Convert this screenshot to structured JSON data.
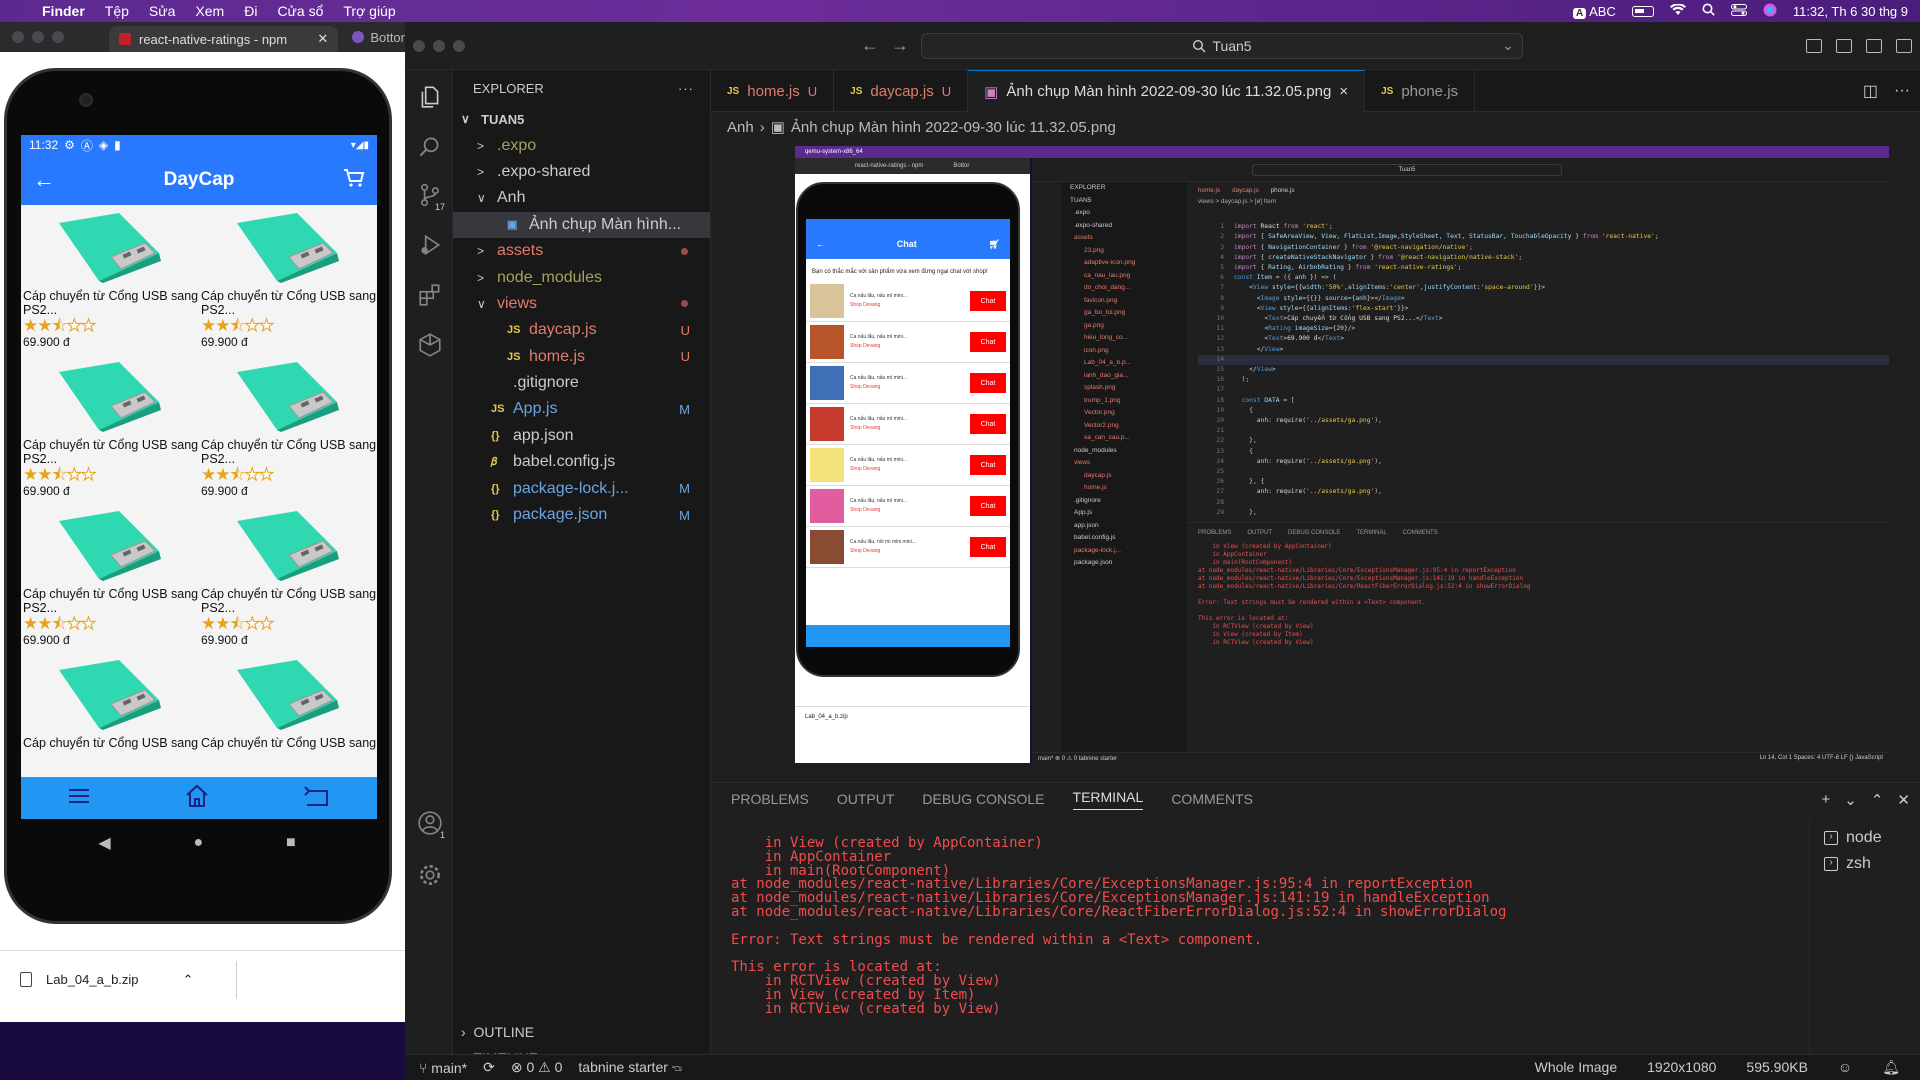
{
  "menubar": {
    "app": "Finder",
    "items": [
      "Tệp",
      "Sửa",
      "Xem",
      "Đi",
      "Cửa sổ",
      "Trợ giúp"
    ],
    "keyboard": "ABC",
    "clock": "11:32, Th 6 30 thg 9"
  },
  "browser": {
    "tab_title": "react-native-ratings - npm",
    "tab2_title": "Bottor",
    "download_file": "Lab_04_a_b.zip"
  },
  "phone": {
    "time": "11:32",
    "app_title": "DayCap",
    "products": [
      {
        "name": "Cáp chuyển từ Cổng USB sang PS2...",
        "price": "69.900 đ",
        "rating": 2.5
      },
      {
        "name": "Cáp chuyển từ Cổng USB sang PS2...",
        "price": "69.900 đ",
        "rating": 2.5
      },
      {
        "name": "Cáp chuyển từ Cổng USB sang PS2...",
        "price": "69.900 đ",
        "rating": 2.5
      },
      {
        "name": "Cáp chuyển từ Cổng USB sang PS2...",
        "price": "69.900 đ",
        "rating": 2.5
      },
      {
        "name": "Cáp chuyển từ Cổng USB sang PS2...",
        "price": "69.900 đ",
        "rating": 2.5
      },
      {
        "name": "Cáp chuyển từ Cổng USB sang PS2...",
        "price": "69.900 đ",
        "rating": 2.5
      },
      {
        "name": "Cáp chuyển từ Cổng USB sang",
        "price": "",
        "rating": 0
      },
      {
        "name": "Cáp chuyển từ Cổng USB sang",
        "price": "",
        "rating": 0
      }
    ]
  },
  "vscode": {
    "search": "Tuan5",
    "explorer_title": "EXPLORER",
    "source_control_badge": "17",
    "accounts_badge": "1",
    "tree": [
      {
        "label": "TUAN5",
        "kind": "root",
        "chev": "∨",
        "indent": 0
      },
      {
        "label": ".expo",
        "kind": "folder",
        "chev": ">",
        "indent": 1,
        "color": "c-olive"
      },
      {
        "label": ".expo-shared",
        "kind": "folder",
        "chev": ">",
        "indent": 1,
        "color": ""
      },
      {
        "label": "Anh",
        "kind": "folder",
        "chev": "∨",
        "indent": 1,
        "color": ""
      },
      {
        "label": "Ảnh chụp Màn hình...",
        "kind": "image",
        "chev": "",
        "indent": 2,
        "color": "",
        "selected": true
      },
      {
        "label": "assets",
        "kind": "folder",
        "chev": ">",
        "indent": 1,
        "color": "c-red",
        "dot": true
      },
      {
        "label": "node_modules",
        "kind": "folder",
        "chev": ">",
        "indent": 1,
        "color": "c-olive"
      },
      {
        "label": "views",
        "kind": "folder",
        "chev": "∨",
        "indent": 1,
        "color": "c-red",
        "dot": true
      },
      {
        "label": "daycap.js",
        "kind": "js",
        "chev": "",
        "indent": 2,
        "color": "c-red",
        "tag": "U"
      },
      {
        "label": "home.js",
        "kind": "js",
        "chev": "",
        "indent": 2,
        "color": "c-red",
        "tag": "U"
      },
      {
        "label": ".gitignore",
        "kind": "git",
        "chev": "",
        "indent": 1,
        "color": ""
      },
      {
        "label": "App.js",
        "kind": "js",
        "chev": "",
        "indent": 1,
        "color": "c-blue",
        "tag": "M"
      },
      {
        "label": "app.json",
        "kind": "json",
        "chev": "",
        "indent": 1,
        "color": ""
      },
      {
        "label": "babel.config.js",
        "kind": "babel",
        "chev": "",
        "indent": 1,
        "color": ""
      },
      {
        "label": "package-lock.j...",
        "kind": "json",
        "chev": "",
        "indent": 1,
        "color": "c-blue",
        "tag": "M"
      },
      {
        "label": "package.json",
        "kind": "json",
        "chev": "",
        "indent": 1,
        "color": "c-blue",
        "tag": "M"
      }
    ],
    "outline": "OUTLINE",
    "timeline": "TIMELINE",
    "tabs": [
      {
        "label": "home.js",
        "icon": "JS",
        "status": "U",
        "active": false
      },
      {
        "label": "daycap.js",
        "icon": "JS",
        "status": "U",
        "active": false
      },
      {
        "label": "Ảnh chụp Màn hình 2022-09-30 lúc 11.32.05.png",
        "icon": "IMG",
        "status": "×",
        "active": true
      },
      {
        "label": "phone.js",
        "icon": "JS",
        "status": "",
        "active": false
      }
    ],
    "breadcrumb": [
      "Anh",
      "Ảnh chụp Màn hình 2022-09-30 lúc 11.32.05.png"
    ],
    "panel_tabs": [
      "PROBLEMS",
      "OUTPUT",
      "DEBUG CONSOLE",
      "TERMINAL",
      "COMMENTS"
    ],
    "terminal_lines": [
      "    in View (created by AppContainer)",
      "    in AppContainer",
      "    in main(RootComponent)",
      "at node_modules/react-native/Libraries/Core/ExceptionsManager.js:95:4 in reportException",
      "at node_modules/react-native/Libraries/Core/ExceptionsManager.js:141:19 in handleException",
      "at node_modules/react-native/Libraries/Core/ReactFiberErrorDialog.js:52:4 in showErrorDialog",
      "",
      "Error: Text strings must be rendered within a <Text> component.",
      "",
      "This error is located at:",
      "    in RCTView (created by View)",
      "    in View (created by Item)",
      "    in RCTView (created by View)"
    ],
    "terminals": [
      "node",
      "zsh"
    ],
    "status": {
      "branch": "main*",
      "errors": "0",
      "warnings": "0",
      "tabnine": "tabnine starter",
      "view_mode": "Whole Image",
      "dimensions": "1920x1080",
      "size": "595.90KB"
    }
  },
  "inner_screenshot": {
    "menubar": "qemu-system-x86_64",
    "browser_tab": "react-native-ratings - npm",
    "browser_tab2": "Bottor",
    "search": "Tuan5",
    "chat_title": "Chat",
    "chat_info": "Bạn có thắc mắc với sản phẩm vừa xem đừng ngại chat với shop!",
    "chat_button": "Chat",
    "chat_items": [
      "Ca nấu lẩu, nấu mì mini...",
      "Ca nấu lẩu, nấu mì mini...",
      "Ca nấu lẩu, nấu mì mini...",
      "Ca nấu lẩu, nấu mì mini...",
      "Ca nấu lẩu, nấu mì mini...",
      "Ca nấu lẩu, nấu mì mini...",
      "Ca nấu lẩu, nồi mì mini mini..."
    ],
    "shop": "Shop Devang",
    "download": "Lab_04_a_b.zip",
    "explorer": "EXPLORER",
    "root": "TUAN5",
    "files": [
      ".expo",
      ".expo-shared",
      "assets",
      "23.png",
      "adaptive-icon.png",
      "ca_nau_lau.png",
      "do_choi_dang...",
      "favicon.png",
      "ga_bo_toi.png",
      "ga.png",
      "hieu_long_co...",
      "icon.png",
      "Lab_04_a_b.p...",
      "lanh_dao_gia...",
      "splash.png",
      "trump_1.png",
      "Vector.png",
      "Vector2.png",
      "xa_can_cau.p...",
      "node_modules",
      "views",
      "daycap.js",
      "home.js",
      ".gitignore",
      "App.js",
      "app.json",
      "babel.config.js",
      "package-lock.j...",
      "package.json"
    ],
    "tabs": [
      "home.js",
      "daycap.js",
      "phone.js"
    ],
    "breadcrumb": "views > daycap.js > [ø] Item",
    "panel_tabs": [
      "PROBLEMS",
      "OUTPUT",
      "DEBUG CONSOLE",
      "TERMINAL",
      "COMMENTS"
    ],
    "terminal": [
      "    in View (created by AppContainer)",
      "    in AppContainer",
      "    in main(RootComponent)",
      "at node_modules/react-native/Libraries/Core/ExceptionsManager.js:95:4 in reportException",
      "at node_modules/react-native/Libraries/Core/ExceptionsManager.js:141:19 in handleException",
      "at node_modules/react-native/Libraries/Core/ReactFiberErrorDialog.js:52:4 in showErrorDialog",
      "",
      "Error: Text strings must be rendered within a <Text> component.",
      "",
      "This error is located at:",
      "    in RCTView (created by View)",
      "    in View (created by Item)",
      "    in RCTView (created by View)"
    ],
    "terminals": [
      "node",
      "zsh"
    ],
    "status_left": "main*  ⊗ 0 ⚠ 0  tabnine starter",
    "status_right": "Ln 14, Col 1   Spaces: 4   UTF-8   LF   {} JavaScript"
  }
}
